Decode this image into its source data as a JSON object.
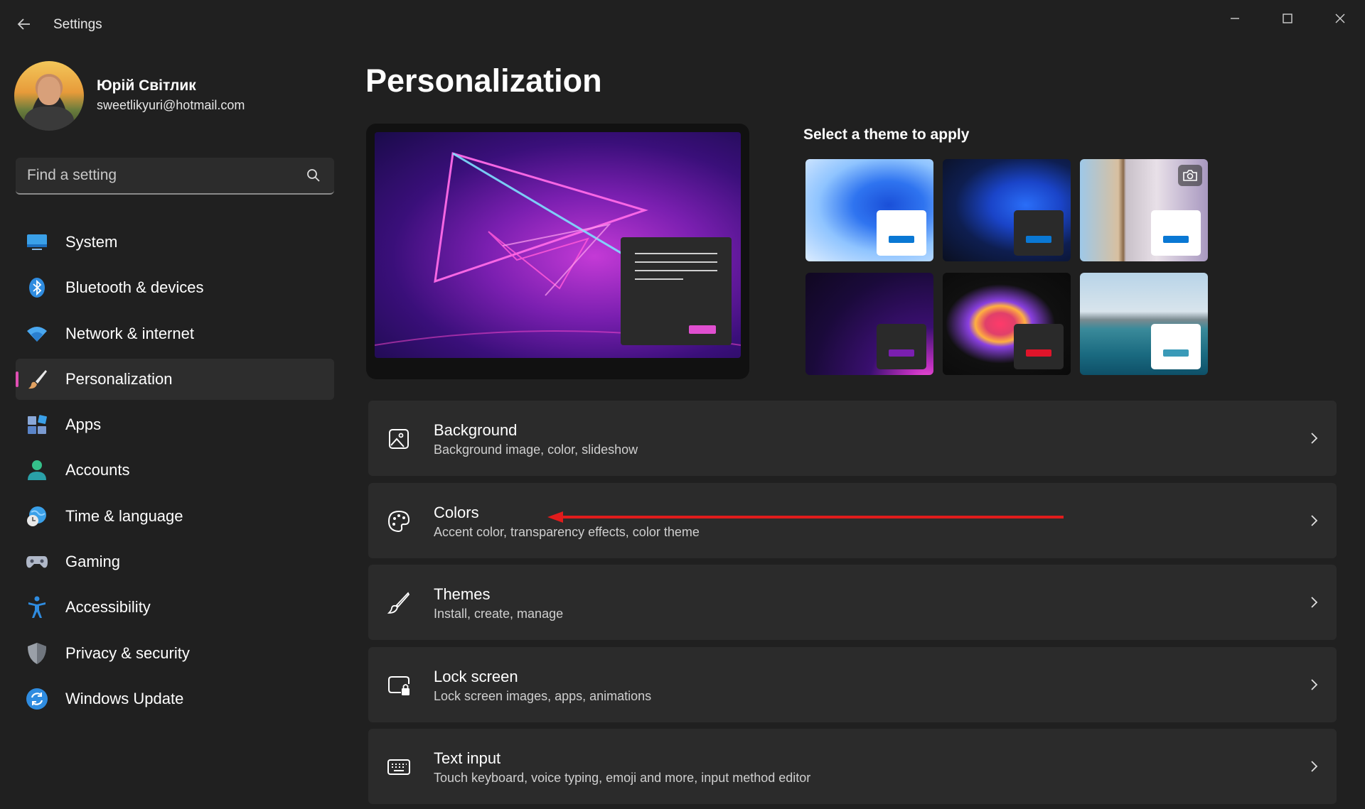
{
  "window": {
    "title": "Settings",
    "back_icon": "arrow-left-icon",
    "minimize_icon": "minimize-icon",
    "maximize_icon": "maximize-icon",
    "close_icon": "close-icon"
  },
  "profile": {
    "name": "Юрій Світлик",
    "email": "sweetlikyuri@hotmail.com"
  },
  "search": {
    "placeholder": "Find a setting",
    "icon": "search-icon"
  },
  "nav": {
    "items": [
      {
        "label": "System",
        "icon": "system-icon",
        "color": "#3aa0e8"
      },
      {
        "label": "Bluetooth & devices",
        "icon": "bluetooth-icon",
        "color": "#2f8ce0"
      },
      {
        "label": "Network & internet",
        "icon": "wifi-icon",
        "color": "#4aa8f0"
      },
      {
        "label": "Personalization",
        "icon": "brush-icon",
        "color": "#e0a060",
        "active": true
      },
      {
        "label": "Apps",
        "icon": "apps-icon",
        "color": "#8aa8d8"
      },
      {
        "label": "Accounts",
        "icon": "accounts-icon",
        "color": "#35c08a"
      },
      {
        "label": "Time & language",
        "icon": "globe-clock-icon",
        "color": "#3aa0e8"
      },
      {
        "label": "Gaming",
        "icon": "gamepad-icon",
        "color": "#b0b8c8"
      },
      {
        "label": "Accessibility",
        "icon": "accessibility-icon",
        "color": "#2f8ce0"
      },
      {
        "label": "Privacy & security",
        "icon": "shield-icon",
        "color": "#9aa0a8"
      },
      {
        "label": "Windows Update",
        "icon": "update-icon",
        "color": "#2f8ce0"
      }
    ],
    "active_indicator_color": "#e04fb3"
  },
  "main": {
    "page_title": "Personalization",
    "themes_title": "Select a theme to apply",
    "themes": [
      {
        "name": "windows-light-bloom",
        "badge": "#ffffff",
        "bar": "#0a78d4"
      },
      {
        "name": "windows-dark-bloom",
        "badge": "#2a2a2a",
        "bar": "#0a78d4"
      },
      {
        "name": "windows-spotlight",
        "badge": "#ffffff",
        "bar": "#0a78d4",
        "camera_icon": "camera-icon"
      },
      {
        "name": "glow",
        "badge": "#2a2a2a",
        "bar": "#7a1fb0"
      },
      {
        "name": "captured-motion",
        "badge": "#2a2a2a",
        "bar": "#e0142a"
      },
      {
        "name": "flow",
        "badge": "#ffffff",
        "bar": "#3a9ab8"
      }
    ],
    "settings": [
      {
        "title": "Background",
        "desc": "Background image, color, slideshow",
        "icon": "image-icon"
      },
      {
        "title": "Colors",
        "desc": "Accent color, transparency effects, color theme",
        "icon": "palette-icon"
      },
      {
        "title": "Themes",
        "desc": "Install, create, manage",
        "icon": "brush-icon"
      },
      {
        "title": "Lock screen",
        "desc": "Lock screen images, apps, animations",
        "icon": "lock-screen-icon"
      },
      {
        "title": "Text input",
        "desc": "Touch keyboard, voice typing, emoji and more, input method editor",
        "icon": "keyboard-icon"
      }
    ],
    "annotation_color": "#e01c1c"
  }
}
